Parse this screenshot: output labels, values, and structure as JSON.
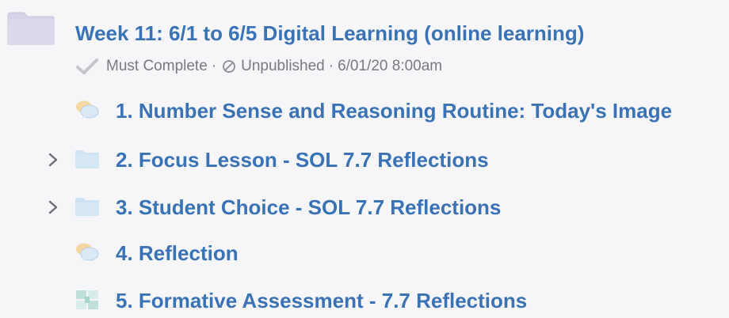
{
  "folder": {
    "title": "Week 11: 6/1 to 6/5 Digital Learning (online learning)",
    "requirement": "Must Complete",
    "separator": "·",
    "status": "Unpublished",
    "date": "6/01/20 8:00am"
  },
  "items": [
    {
      "label": "1. Number Sense and Reasoning Routine: Today's Image",
      "icon": "discussion-icon",
      "expandable": false
    },
    {
      "label": "2. Focus Lesson - SOL 7.7 Reflections",
      "icon": "folder-icon",
      "expandable": true
    },
    {
      "label": "3. Student Choice - SOL 7.7 Reflections",
      "icon": "folder-icon",
      "expandable": true
    },
    {
      "label": "4. Reflection",
      "icon": "discussion-icon",
      "expandable": false
    },
    {
      "label": "5. Formative Assessment - 7.7 Reflections",
      "icon": "assessment-icon",
      "expandable": false
    }
  ],
  "colors": {
    "link": "#3a73b5",
    "meta_text": "#777a80",
    "big_folder": "#d7d3e8",
    "small_folder": "#cfe3f3",
    "discussion": "#f4d7a3",
    "assessment": "#bfe0db",
    "background": "#f6f6f8"
  }
}
